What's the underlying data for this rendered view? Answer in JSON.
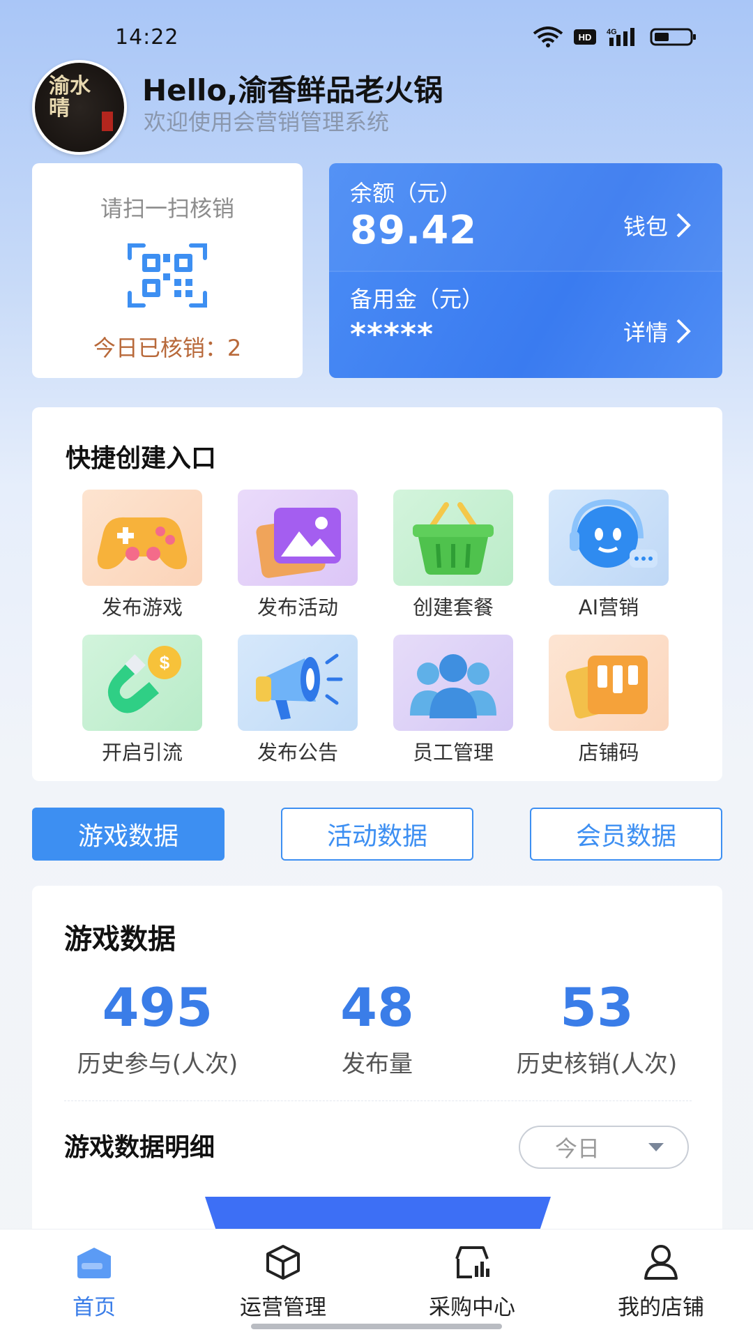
{
  "status_bar": {
    "time": "14:22",
    "network": "4G",
    "hd": "HD"
  },
  "header": {
    "avatar_text": "渝水晴",
    "greeting": "Hello,渝香鲜品老火锅",
    "subtitle": "欢迎使用会营销管理系统"
  },
  "scan_card": {
    "title": "请扫一扫核销",
    "count_label": "今日已核销：2"
  },
  "balance_card": {
    "balance_label": "余额（元）",
    "balance_value": "89.42",
    "wallet_link": "钱包",
    "reserve_label": "备用金（元）",
    "reserve_value": "*****",
    "details_link": "详情"
  },
  "quick_create": {
    "title": "快捷创建入口",
    "items": [
      {
        "label": "发布游戏",
        "icon": "gamepad-icon"
      },
      {
        "label": "发布活动",
        "icon": "image-card-icon"
      },
      {
        "label": "创建套餐",
        "icon": "shopping-basket-icon"
      },
      {
        "label": "AI营销",
        "icon": "robot-headset-icon"
      },
      {
        "label": "开启引流",
        "icon": "magnet-coin-icon"
      },
      {
        "label": "发布公告",
        "icon": "megaphone-icon"
      },
      {
        "label": "员工管理",
        "icon": "people-group-icon"
      },
      {
        "label": "店铺码",
        "icon": "store-card-icon"
      }
    ]
  },
  "tabs": [
    {
      "label": "游戏数据",
      "active": true
    },
    {
      "label": "活动数据",
      "active": false
    },
    {
      "label": "会员数据",
      "active": false
    }
  ],
  "game_data": {
    "title": "游戏数据",
    "stats": [
      {
        "value": "495",
        "label": "历史参与(人次)"
      },
      {
        "value": "48",
        "label": "发布量"
      },
      {
        "value": "53",
        "label": "历史核销(人次)"
      }
    ],
    "detail_title": "游戏数据明细",
    "date_filter": "今日"
  },
  "bottom_nav": [
    {
      "label": "首页",
      "icon": "home-icon",
      "active": true
    },
    {
      "label": "运营管理",
      "icon": "box-icon",
      "active": false
    },
    {
      "label": "采购中心",
      "icon": "store-chart-icon",
      "active": false
    },
    {
      "label": "我的店铺",
      "icon": "user-icon",
      "active": false
    }
  ],
  "colors": {
    "accent": "#3d8ff2",
    "stat": "#3a7de8",
    "balance_card": "#3a7bf0",
    "scan_count": "#b8693a"
  }
}
